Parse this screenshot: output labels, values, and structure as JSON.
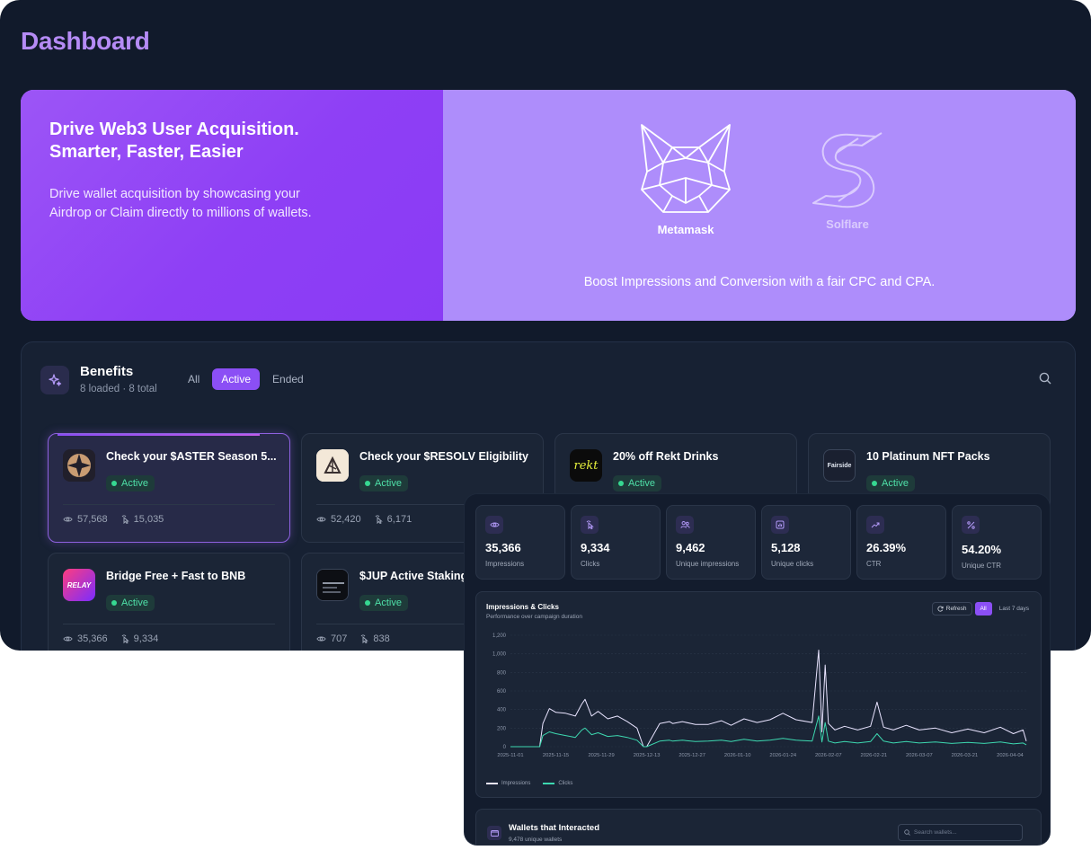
{
  "page": {
    "title": "Dashboard"
  },
  "hero": {
    "headline": "Drive Web3 User Acquisition. Smarter, Faster, Easier",
    "description": "Drive wallet acquisition by showcasing your Airdrop or Claim directly to millions of wallets.",
    "partners": [
      {
        "name": "Metamask",
        "icon": "metamask-fox-icon"
      },
      {
        "name": "Solflare",
        "icon": "solflare-s-icon"
      }
    ],
    "tagline": "Boost Impressions and Conversion with a fair CPC and CPA."
  },
  "benefits": {
    "title": "Benefits",
    "subtitle": "8 loaded · 8 total",
    "tabs": [
      "All",
      "Active",
      "Ended"
    ],
    "active_tab": "Active",
    "cards": [
      {
        "title": "Check your $ASTER Season 5...",
        "status": "Active",
        "views": "57,568",
        "clicks": "15,035",
        "logo": "aster-logo"
      },
      {
        "title": "Check your $RESOLV Eligibility",
        "status": "Active",
        "views": "52,420",
        "clicks": "6,171",
        "logo": "resolv-logo"
      },
      {
        "title": "20% off Rekt Drinks",
        "status": "Active",
        "views": "",
        "clicks": "",
        "logo": "rekt-logo",
        "logo_text": "rekt"
      },
      {
        "title": "10 Platinum NFT Packs",
        "status": "Active",
        "views": "",
        "clicks": "",
        "logo": "fairside-logo",
        "logo_text": "Fairside"
      },
      {
        "title": "Bridge Free + Fast to BNB",
        "status": "Active",
        "views": "35,366",
        "clicks": "9,334",
        "logo": "relay-logo",
        "logo_text": "RELAY"
      },
      {
        "title": "$JUP Active Staking",
        "status": "Active",
        "views": "707",
        "clicks": "838",
        "logo": "jup-logo"
      }
    ]
  },
  "analytics": {
    "kpis": [
      {
        "value": "35,366",
        "label": "Impressions",
        "icon": "eye-icon"
      },
      {
        "value": "9,334",
        "label": "Clicks",
        "icon": "pointer-click-icon"
      },
      {
        "value": "9,462",
        "label": "Unique impressions",
        "icon": "users-icon"
      },
      {
        "value": "5,128",
        "label": "Unique clicks",
        "icon": "bar-chart-icon"
      },
      {
        "value": "26.39%",
        "label": "CTR",
        "icon": "trend-up-icon"
      },
      {
        "value": "54.20%",
        "label": "Unique CTR",
        "icon": "percent-icon"
      }
    ],
    "chart": {
      "title": "Impressions & Clicks",
      "subtitle": "Performance over campaign duration",
      "refresh_label": "Refresh",
      "ranges": [
        "All",
        "Last 7 days"
      ],
      "active_range": "All"
    },
    "wallets": {
      "title": "Wallets that Interacted",
      "subtitle": "9,478 unique wallets",
      "search_placeholder": "Search wallets..."
    }
  },
  "colors": {
    "background": "#111a2b",
    "accent": "#8b4ff5",
    "title": "#b58bf5",
    "active_green": "#36d891",
    "impressions_line": "#e9e4ff",
    "clicks_line": "#3dd8b0"
  },
  "chart_data": {
    "type": "line",
    "title": "Impressions & Clicks",
    "subtitle": "Performance over campaign duration",
    "x_ticks": [
      "2025-11-01",
      "2025-11-15",
      "2025-11-29",
      "2025-12-13",
      "2025-12-27",
      "2026-01-10",
      "2026-01-24",
      "2026-02-07",
      "2026-02-21",
      "2026-03-07",
      "2026-03-21",
      "2026-04-04"
    ],
    "y_ticks": [
      0,
      200,
      400,
      600,
      800,
      1000,
      1200
    ],
    "ylim": [
      0,
      1200
    ],
    "grid": true,
    "legend_position": "bottom-left",
    "series": [
      {
        "name": "Impressions",
        "x": [
          "2025-11-01",
          "2025-11-06",
          "2025-11-10",
          "2025-11-11",
          "2025-11-13",
          "2025-11-15",
          "2025-11-18",
          "2025-11-21",
          "2025-11-23",
          "2025-11-24",
          "2025-11-26",
          "2025-11-28",
          "2025-12-01",
          "2025-12-04",
          "2025-12-07",
          "2025-12-10",
          "2025-12-12",
          "2025-12-13",
          "2025-12-17",
          "2025-12-20",
          "2025-12-21",
          "2025-12-24",
          "2025-12-28",
          "2026-01-01",
          "2026-01-05",
          "2026-01-08",
          "2026-01-12",
          "2026-01-16",
          "2026-01-20",
          "2026-01-24",
          "2026-01-28",
          "2026-02-02",
          "2026-02-04",
          "2026-02-05",
          "2026-02-06",
          "2026-02-07",
          "2026-02-09",
          "2026-02-12",
          "2026-02-16",
          "2026-02-20",
          "2026-02-22",
          "2026-02-24",
          "2026-02-27",
          "2026-03-03",
          "2026-03-07",
          "2026-03-12",
          "2026-03-17",
          "2026-03-22",
          "2026-03-27",
          "2026-04-01",
          "2026-04-05",
          "2026-04-08",
          "2026-04-09"
        ],
        "values": [
          0,
          0,
          0,
          250,
          410,
          370,
          360,
          330,
          460,
          510,
          330,
          380,
          300,
          330,
          270,
          200,
          0,
          0,
          250,
          270,
          250,
          270,
          240,
          240,
          280,
          230,
          300,
          260,
          290,
          360,
          290,
          260,
          1040,
          160,
          880,
          250,
          180,
          220,
          180,
          220,
          480,
          210,
          180,
          230,
          180,
          200,
          150,
          190,
          150,
          210,
          140,
          180,
          60
        ]
      },
      {
        "name": "Clicks",
        "x": [
          "2025-11-01",
          "2025-11-06",
          "2025-11-10",
          "2025-11-11",
          "2025-11-13",
          "2025-11-15",
          "2025-11-18",
          "2025-11-21",
          "2025-11-23",
          "2025-11-24",
          "2025-11-26",
          "2025-11-28",
          "2025-12-01",
          "2025-12-04",
          "2025-12-07",
          "2025-12-10",
          "2025-12-12",
          "2025-12-13",
          "2025-12-17",
          "2025-12-20",
          "2025-12-21",
          "2025-12-24",
          "2025-12-28",
          "2026-01-01",
          "2026-01-05",
          "2026-01-08",
          "2026-01-12",
          "2026-01-16",
          "2026-01-20",
          "2026-01-24",
          "2026-01-28",
          "2026-02-02",
          "2026-02-04",
          "2026-02-05",
          "2026-02-06",
          "2026-02-07",
          "2026-02-09",
          "2026-02-12",
          "2026-02-16",
          "2026-02-20",
          "2026-02-22",
          "2026-02-24",
          "2026-02-27",
          "2026-03-03",
          "2026-03-07",
          "2026-03-12",
          "2026-03-17",
          "2026-03-22",
          "2026-03-27",
          "2026-04-01",
          "2026-04-05",
          "2026-04-08",
          "2026-04-09"
        ],
        "values": [
          0,
          0,
          0,
          120,
          160,
          140,
          120,
          100,
          180,
          200,
          130,
          150,
          110,
          120,
          100,
          70,
          0,
          0,
          60,
          70,
          60,
          70,
          55,
          60,
          70,
          55,
          80,
          60,
          70,
          90,
          70,
          60,
          330,
          50,
          260,
          60,
          40,
          55,
          40,
          55,
          140,
          60,
          40,
          55,
          40,
          50,
          35,
          45,
          35,
          50,
          30,
          40,
          20
        ]
      }
    ]
  }
}
